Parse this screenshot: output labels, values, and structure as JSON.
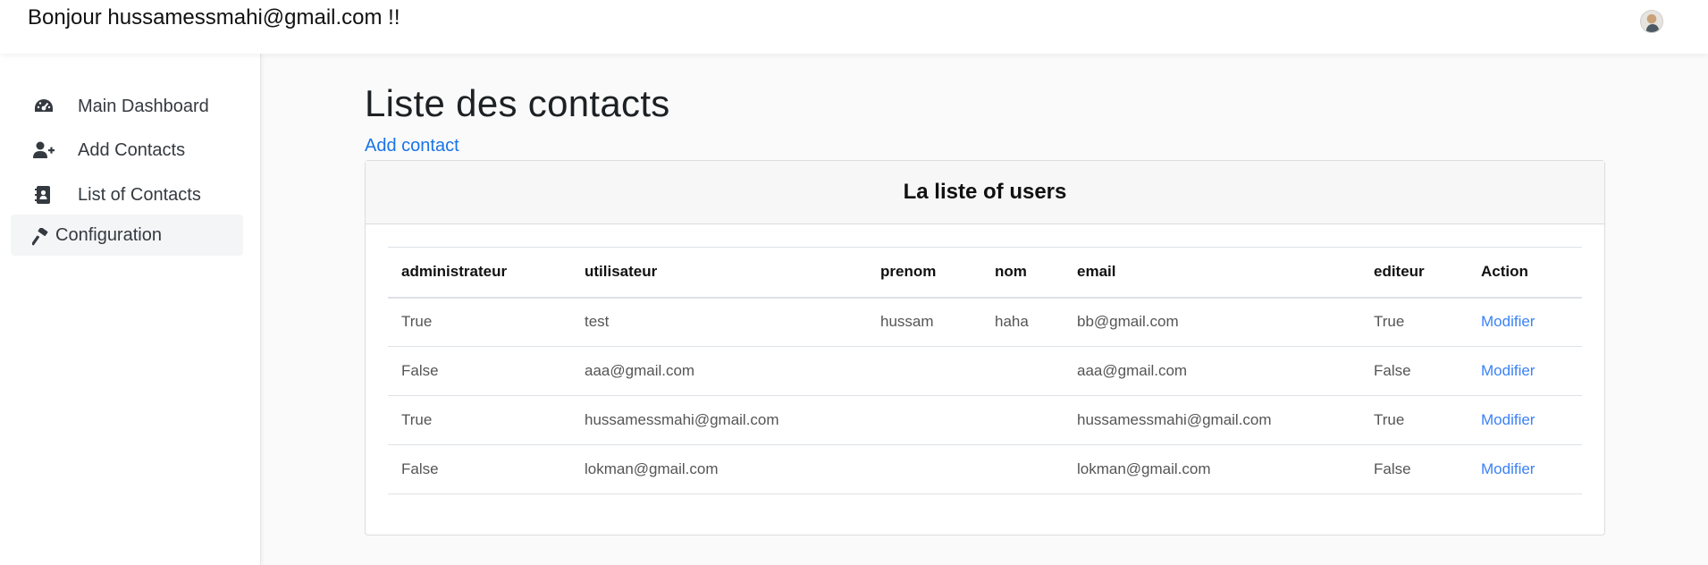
{
  "header": {
    "greeting": "Bonjour hussamessmahi@gmail.com !!"
  },
  "sidebar": {
    "items": [
      {
        "label": "Main Dashboard",
        "icon": "dashboard-gauge-icon"
      },
      {
        "label": "Add Contacts",
        "icon": "user-plus-icon"
      },
      {
        "label": "List of Contacts",
        "icon": "contact-book-icon"
      },
      {
        "label": "Configuration",
        "icon": "hammer-icon",
        "active": true
      }
    ]
  },
  "main": {
    "title": "Liste des contacts",
    "add_link": "Add contact",
    "card_title": "La liste of users",
    "table": {
      "headers": [
        "administrateur",
        "utilisateur",
        "prenom",
        "nom",
        "email",
        "editeur",
        "Action"
      ],
      "rows": [
        [
          "True",
          "test",
          "hussam",
          "haha",
          "bb@gmail.com",
          "True",
          "Modifier"
        ],
        [
          "False",
          "aaa@gmail.com",
          "",
          "",
          "aaa@gmail.com",
          "False",
          "Modifier"
        ],
        [
          "True",
          "hussamessmahi@gmail.com",
          "",
          "",
          "hussamessmahi@gmail.com",
          "True",
          "Modifier"
        ],
        [
          "False",
          "lokman@gmail.com",
          "",
          "",
          "lokman@gmail.com",
          "False",
          "Modifier"
        ]
      ]
    }
  },
  "colors": {
    "link": "#1a73e8",
    "action_link": "#3b82f6",
    "sidebar_active_bg": "#f4f5f7"
  }
}
